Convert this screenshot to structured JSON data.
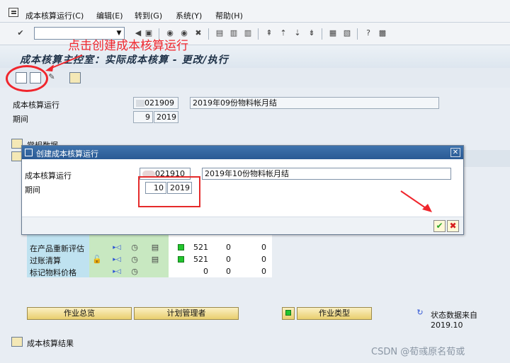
{
  "menubar": {
    "items": [
      "成本核算运行(C)",
      "编辑(E)",
      "转到(G)",
      "系统(Y)",
      "帮助(H)"
    ]
  },
  "annotation": "点击创建成本核算运行",
  "page_title": "成本核算主控室：实际成本核算 - 更改/执行",
  "main": {
    "run_label": "成本核算运行",
    "run_id": "021909",
    "run_desc": "2019年09份物料帐月结",
    "period_label": "期间",
    "period": "9",
    "year": "2019",
    "basic_data_label": "常规数据"
  },
  "dialog": {
    "title": "创建成本核算运行",
    "run_label": "成本核算运行",
    "run_id": "021910",
    "run_desc": "2019年10份物料帐月结",
    "period_label": "期间",
    "period": "10",
    "year": "2019"
  },
  "steps": [
    {
      "label": "在产品重新评估",
      "n1": "521",
      "n2": "0",
      "n3": "0"
    },
    {
      "label": "过账清算",
      "n1": "521",
      "n2": "0",
      "n3": "0"
    },
    {
      "label": "标记物料价格",
      "n1": "0",
      "n2": "0",
      "n3": "0"
    }
  ],
  "buttons": {
    "overview": "作业总览",
    "planner": "计划管理者",
    "job_type": "作业类型"
  },
  "status_text": "状态数据来自 2019.10",
  "results_label": "成本核算结果",
  "watermark": "CSDN @荀彧原名荀或",
  "colors": {
    "accent_red": "#f0262d",
    "dialog_blue": "#2a5a94"
  }
}
